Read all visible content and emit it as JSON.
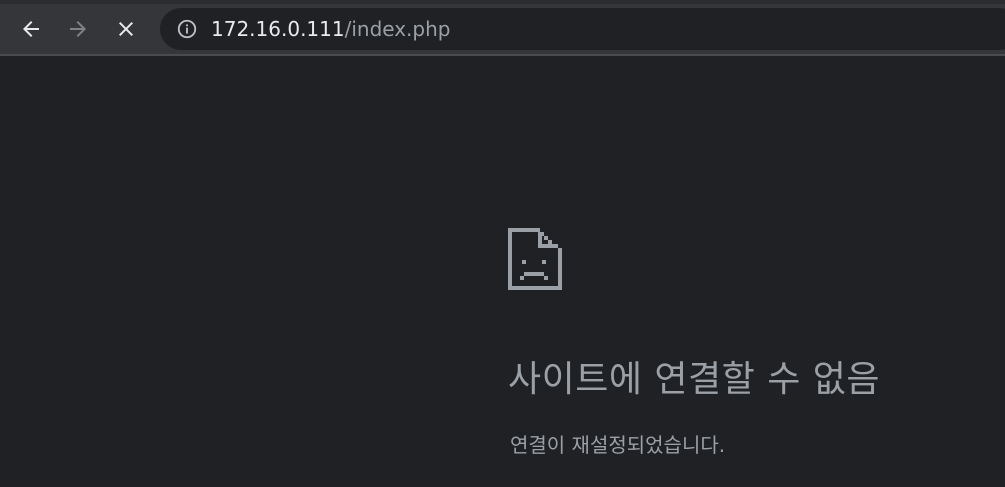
{
  "browser": {
    "back_icon": "arrow-left-icon",
    "forward_icon": "arrow-right-icon",
    "stop_icon": "close-icon",
    "info_icon": "info-circle-icon",
    "url_host": "172.16.0.111",
    "url_path": "/index.php"
  },
  "error_page": {
    "icon": "sad-page-icon",
    "title": "사이트에 연결할 수 없음",
    "subtitle": "연결이 재설정되었습니다."
  },
  "colors": {
    "toolbar": "#35363a",
    "page_background": "#202124",
    "primary_text": "#e8eaed",
    "secondary_text": "#9aa0a6"
  }
}
